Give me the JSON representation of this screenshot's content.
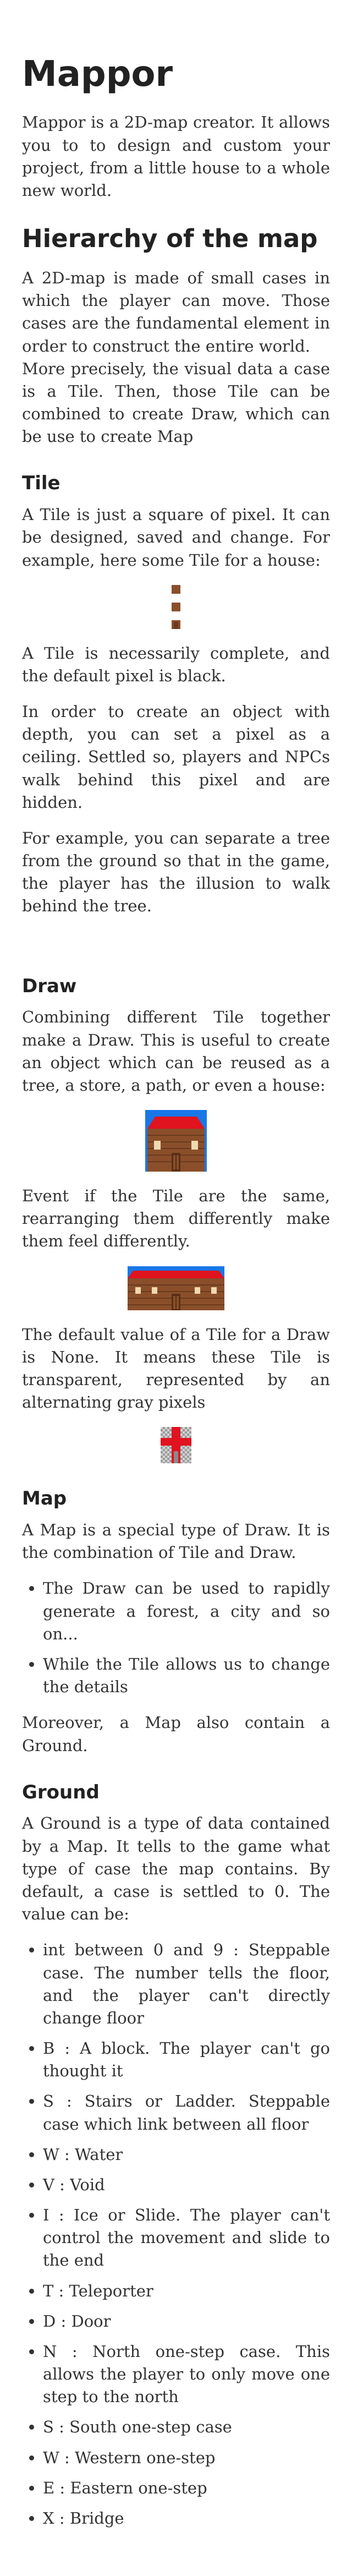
{
  "title": "Mappor",
  "intro": "Mappor is a 2D-map creator. It allows you to to design and custom your project, from a little house to a whole new world.",
  "hierarchy": {
    "heading": "Hierarchy of the map",
    "p1": "A 2D-map is made of small cases in which the player can move. Those cases are the fundamental element in order to construct the entire world.",
    "p2": "More precisely, the visual data a case is a Tile. Then, those Tile can be combined to create Draw, which can be use to create Map"
  },
  "tile": {
    "heading": "Tile",
    "p1": "A Tile is just a square of pixel. It can be designed, saved and change. For example, here some Tile for a house:",
    "p2": "A Tile is necessarily complete, and the default pixel is black.",
    "p3": "In order to create an object with depth, you can set a pixel as a ceiling. Settled so, players and NPCs walk behind this pixel and are hidden.",
    "p4": "For example, you can separate a tree from the ground so that in the game, the player has the illusion to walk behind the tree."
  },
  "draw": {
    "heading": "Draw",
    "p1": "Combining different Tile together make a Draw. This is useful to create an object which can be reused as a tree, a store, a path, or even a house:",
    "p2": "Event if the Tile are the same, rearranging them differently make them feel differently.",
    "p3": "The default value of a Tile for a Draw is None. It means these Tile is transparent, represented by an alternating gray pixels"
  },
  "map": {
    "heading": "Map",
    "p1": "A Map is a special type of Draw. It is the combination of Tile and Draw.",
    "bullets": [
      "The Draw can be used to rapidly generate a forest, a city and so on...",
      "While the Tile allows us to change the details"
    ],
    "p2": "Moreover, a Map also contain a Ground."
  },
  "ground": {
    "heading": "Ground",
    "p1": "A Ground is a type of data contained by a Map. It tells to the game what type of case the map contains. By default, a case is settled to 0. The value can be:",
    "bullets": [
      "int between 0 and 9 : Steppable case. The number tells the floor, and the player can't directly change floor",
      "B : A block. The player can't go thought it",
      "S : Stairs or Ladder. Steppable case which link between all floor",
      "W : Water",
      "V : Void",
      "I : Ice or Slide. The player can't control the movement and slide to the end",
      "T : Teleporter",
      "D : Door",
      "N : North one-step case. This allows the player to only move one step to the north",
      "S : South one-step case",
      "W : Western one-step",
      "E : Eastern one-step",
      "X : Bridge"
    ]
  },
  "colors": {
    "brick": "#8a4f2a",
    "roof": "#e0131f",
    "sky": "#1877e8",
    "text": "#333333"
  }
}
